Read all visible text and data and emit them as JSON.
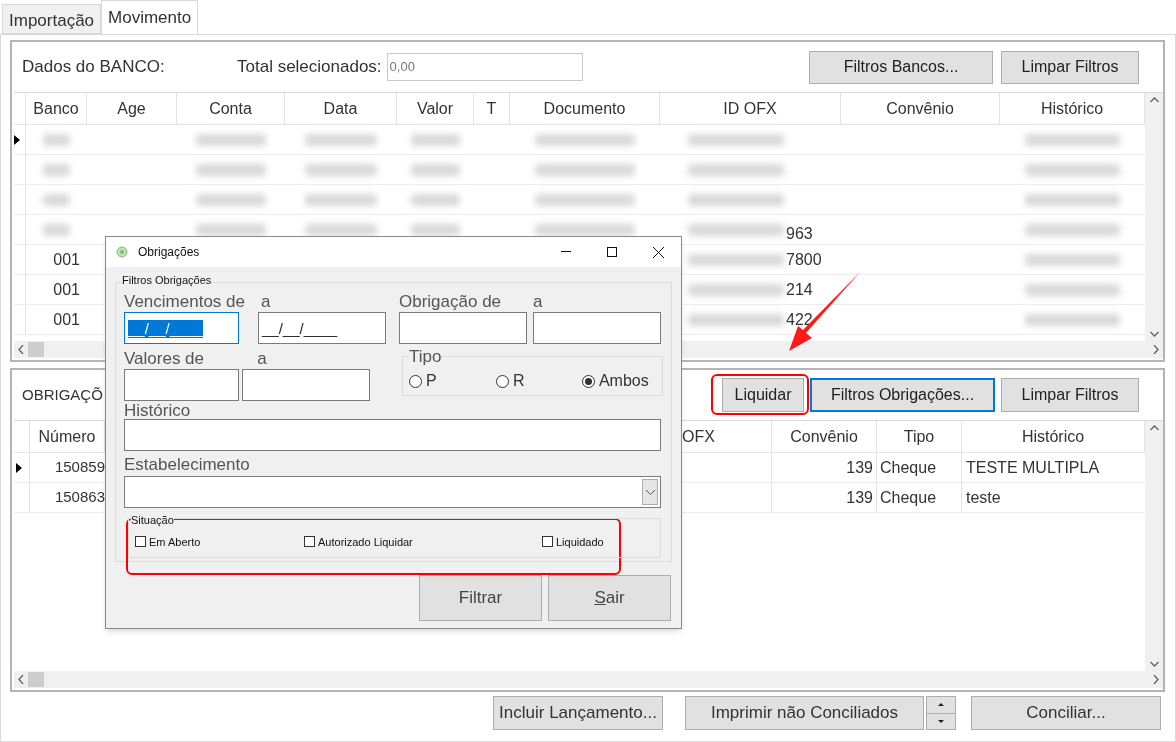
{
  "tabs": [
    {
      "label": "Importação",
      "selected": false
    },
    {
      "label": "Movimento",
      "selected": true
    }
  ],
  "bank_panel": {
    "title": "Dados do BANCO:",
    "total_label": "Total selecionados:",
    "total_value": "0,00",
    "buttons": [
      {
        "label": "Filtros Bancos...",
        "focused": false,
        "annotated": false
      },
      {
        "label": "Limpar Filtros",
        "focused": false,
        "annotated": false
      }
    ],
    "table": {
      "columns": [
        "Banco",
        "Age",
        "Conta",
        "Data",
        "Valor",
        "T",
        "Documento",
        "ID OFX",
        "Convênio",
        "Histórico"
      ],
      "rows": [
        {
          "selected": true
        },
        {
          "selected": false
        },
        {
          "selected": false
        },
        {
          "selected": false,
          "id_ofx": "963"
        },
        {
          "selected": false,
          "banco": "001",
          "id_ofx": "7800"
        },
        {
          "selected": false,
          "banco": "001",
          "id_ofx": "214"
        },
        {
          "selected": false,
          "banco": "001",
          "id_ofx": "422"
        }
      ]
    }
  },
  "obligations_panel": {
    "title": "OBRIGAÇÕ",
    "buttons": [
      {
        "label": "Liquidar",
        "focused": false,
        "annotated": true
      },
      {
        "label": "Filtros Obrigações...",
        "focused": true,
        "annotated": false
      },
      {
        "label": "Limpar Filtros",
        "focused": false,
        "annotated": false
      }
    ],
    "table": {
      "columns": [
        "Número",
        "OFX",
        "Convênio",
        "Tipo",
        "Histórico"
      ],
      "rows": [
        {
          "selected": true,
          "numero": "150859",
          "convenio": "139",
          "tipo": "Cheque",
          "historico": "TESTE MULTIPLA"
        },
        {
          "selected": false,
          "numero": "150863",
          "convenio": "139",
          "tipo": "Cheque",
          "historico": "teste"
        }
      ]
    }
  },
  "footer": [
    {
      "kind": "button",
      "label": "Incluir Lançamento..."
    },
    {
      "kind": "button",
      "label": "Imprimir não Conciliados"
    },
    {
      "kind": "spinner"
    },
    {
      "kind": "button",
      "label": "Conciliar..."
    }
  ],
  "dialog": {
    "title": "Obrigações",
    "group_title": "Filtros Obrigações",
    "vencimentos": {
      "label": "Vencimentos de",
      "to_label": "a",
      "from_value": "__/__/____",
      "to_value": "__/__/____"
    },
    "obrigacao": {
      "label": "Obrigação de",
      "to_label": "a"
    },
    "valores": {
      "label": "Valores de",
      "to_label": "a"
    },
    "tipo": {
      "label": "Tipo",
      "options": [
        {
          "label": "P",
          "selected": false
        },
        {
          "label": "R",
          "selected": false
        },
        {
          "label": "Ambos",
          "selected": true
        }
      ]
    },
    "historico": {
      "label": "Histórico"
    },
    "estabelecimento": {
      "label": "Estabelecimento"
    },
    "situacao": {
      "label": "Situação",
      "annotated": true,
      "options": [
        {
          "label": "Em Aberto",
          "checked": false
        },
        {
          "label": "Autorizado Liquidar",
          "checked": false
        },
        {
          "label": "Liquidado",
          "checked": false
        }
      ]
    },
    "buttons": [
      {
        "label": "Filtrar"
      },
      {
        "label": "Sair"
      }
    ]
  },
  "annotation_arrow": true
}
